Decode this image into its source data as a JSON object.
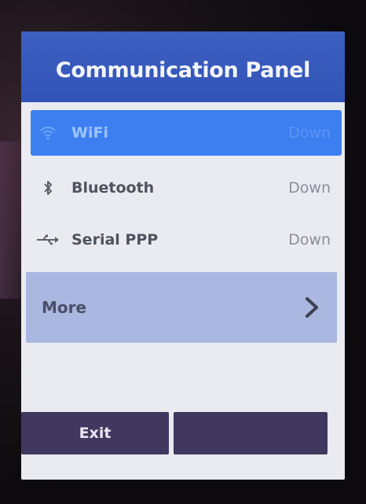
{
  "panel": {
    "title": "Communication Panel"
  },
  "items": [
    {
      "icon": "wifi-icon",
      "label": "WiFi",
      "status": "Down",
      "selected": true
    },
    {
      "icon": "bluetooth-icon",
      "label": "Bluetooth",
      "status": "Down",
      "selected": false
    },
    {
      "icon": "usb-icon",
      "label": "Serial PPP",
      "status": "Down",
      "selected": false
    }
  ],
  "more": {
    "label": "More",
    "icon": "chevron-right-icon"
  },
  "footer": {
    "exit_label": "Exit",
    "second_label": ""
  },
  "colors": {
    "header": "#3254b8",
    "selected_row": "#3d7ff0",
    "more_bg": "#aab7e0",
    "footer_button": "#40385f"
  }
}
